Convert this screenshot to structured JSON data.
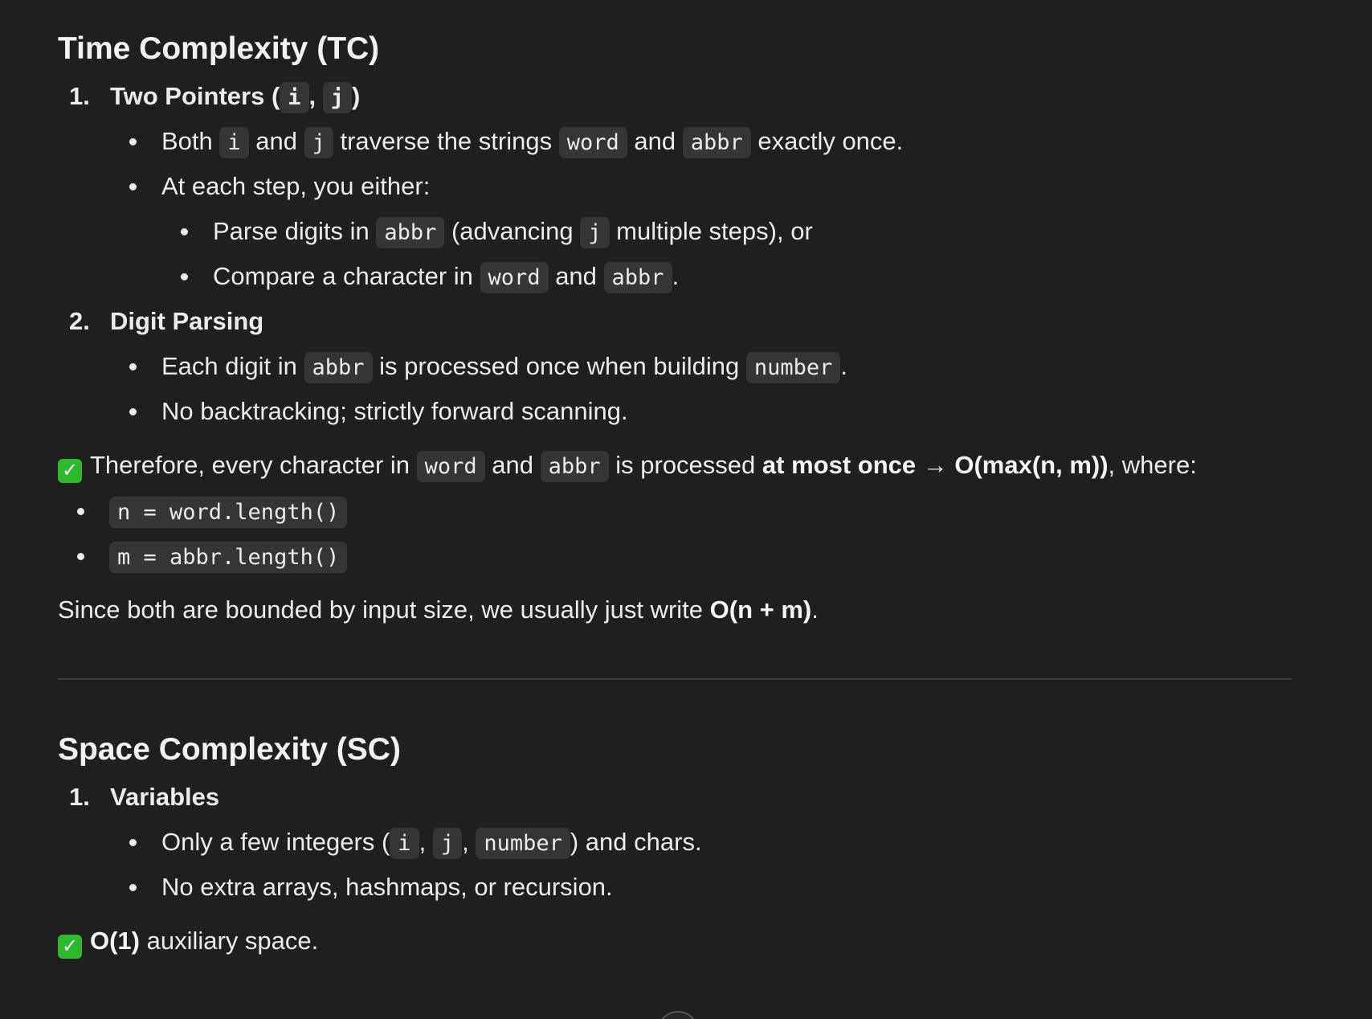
{
  "tc": {
    "heading": "Time Complexity (TC)",
    "item1": {
      "num": "1.",
      "title_pre": "Two Pointers (",
      "code_i": "i",
      "comma": ",",
      "code_j": "j",
      "title_post": ")",
      "b1": {
        "t1": "Both ",
        "c1": "i",
        "t2": " and ",
        "c2": "j",
        "t3": " traverse the strings ",
        "c3": "word",
        "t4": " and ",
        "c4": "abbr",
        "t5": " exactly once."
      },
      "b2": "At each step, you either:",
      "b2a": {
        "t1": "Parse digits in ",
        "c1": "abbr",
        "t2": " (advancing ",
        "c2": "j",
        "t3": " multiple steps), or"
      },
      "b2b": {
        "t1": "Compare a character in ",
        "c1": "word",
        "t2": " and ",
        "c2": "abbr",
        "t3": "."
      }
    },
    "item2": {
      "num": "2.",
      "title": "Digit Parsing",
      "b1": {
        "t1": "Each digit in ",
        "c1": "abbr",
        "t2": " is processed once when building ",
        "c2": "number",
        "t3": "."
      },
      "b2": "No backtracking; strictly forward scanning."
    },
    "conclusion": {
      "check": "✓",
      "t1": "Therefore, every character in ",
      "c1": "word",
      "t2": " and ",
      "c2": "abbr",
      "t3": " is processed ",
      "bold1": "at most once",
      "t4": " → ",
      "bold2": "O(max(n, m))",
      "t5": ", where:"
    },
    "defs": [
      "n = word.length()",
      "m = abbr.length()"
    ],
    "final": {
      "t1": "Since both are bounded by input size, we usually just write ",
      "bold": "O(n + m)",
      "t2": "."
    }
  },
  "sc": {
    "heading": "Space Complexity (SC)",
    "item1": {
      "num": "1.",
      "title": "Variables",
      "b1": {
        "t1": "Only a few integers (",
        "c1": "i",
        "s1": ",",
        "c2": "j",
        "s2": ",",
        "c3": "number",
        "t2": ") and chars."
      },
      "b2": "No extra arrays, hashmaps, or recursion."
    },
    "conclusion": {
      "check": "✓",
      "bold": "O(1)",
      "t1": " auxiliary space."
    }
  },
  "colors": {
    "background": "#1f1f1f",
    "code_bg": "#353535",
    "check_green": "#2eb82e"
  }
}
